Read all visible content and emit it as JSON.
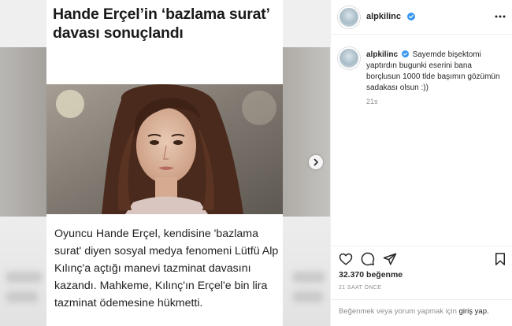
{
  "article": {
    "headline": "Hande Erçel’in ‘bazlama surat’ davası sonuçlandı",
    "body": "Oyuncu Hande Erçel, kendisine 'bazlama surat' diyen sosyal medya fenomeni Lütfü Alp Kılınç'a açtığı  manevi tazminat davasını kazandı. Mahkeme, Kılınç'ın Erçel'e bin lira tazminat ödemesine hükmetti."
  },
  "post": {
    "username": "alpkilinc",
    "caption": "Sayemde bişektomi yaptırdın bugunki eserini bana borçlusun 1000 tlde başımın gözümün sadakası olsun :))",
    "caption_time": "21s",
    "likes": "32.370 beğenme",
    "time_ago": "21 SAAT ÖNCE",
    "login_prompt": "Beğenmek veya yorum yapmak için",
    "login_link": "giriş yap.",
    "icons": [
      "heart-icon",
      "comment-icon",
      "share-icon",
      "bookmark-icon",
      "more-icon",
      "verified-icon",
      "chevron-right-icon"
    ],
    "accent": "#3897f0"
  }
}
